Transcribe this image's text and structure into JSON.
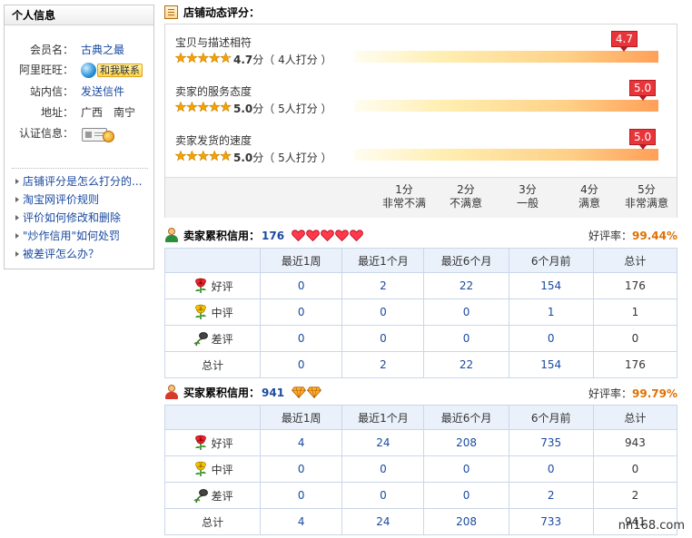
{
  "sidebar": {
    "title": "个人信息",
    "member_label": "会员名：",
    "member_value": "古典之最",
    "aliww_label": "阿里旺旺：",
    "aliww_button": "和我联系",
    "message_label": "站内信：",
    "message_value": "发送信件",
    "address_label": "地址：",
    "address_value": "广西　南宁",
    "cert_label": "认证信息：",
    "links": [
      "店铺评分是怎么打分的...",
      "淘宝网评价规则",
      "评价如何修改和删除",
      "\"炒作信用\"如何处罚",
      "被差评怎么办？"
    ]
  },
  "dsr": {
    "title": "店铺动态评分：",
    "items": [
      {
        "name": "宝贝与描述相符",
        "score": "4.7",
        "unit": "分",
        "count": "（ 4人打分 ）",
        "flag": "4.7",
        "value": 4.7,
        "stars": 4.7
      },
      {
        "name": "卖家的服务态度",
        "score": "5.0",
        "unit": "分",
        "count": "（ 5人打分 ）",
        "flag": "5.0",
        "value": 5.0,
        "stars": 5.0
      },
      {
        "name": "卖家发货的速度",
        "score": "5.0",
        "unit": "分",
        "count": "（ 5人打分 ）",
        "flag": "5.0",
        "value": 5.0,
        "stars": 5.0
      }
    ],
    "scale": [
      {
        "score": "1分",
        "label": "非常不满"
      },
      {
        "score": "2分",
        "label": "不满意"
      },
      {
        "score": "3分",
        "label": "一般"
      },
      {
        "score": "4分",
        "label": "满意"
      },
      {
        "score": "5分",
        "label": "非常满意"
      }
    ]
  },
  "seller": {
    "title": "卖家累积信用：",
    "credit": "176",
    "level_icon": "heart-icon",
    "level_count": 5,
    "good_rate_label": "好评率：",
    "good_rate": "99.44%",
    "headers": [
      "",
      "最近1周",
      "最近1个月",
      "最近6个月",
      "6个月前",
      "总计"
    ],
    "rows": [
      {
        "kind": "好评",
        "icon": "red-flower-icon",
        "values": [
          "0",
          "2",
          "22",
          "154",
          "176"
        ]
      },
      {
        "kind": "中评",
        "icon": "yellow-flower-icon",
        "values": [
          "0",
          "0",
          "0",
          "1",
          "1"
        ]
      },
      {
        "kind": "差评",
        "icon": "wilted-flower-icon",
        "values": [
          "0",
          "0",
          "0",
          "0",
          "0"
        ]
      },
      {
        "kind": "总计",
        "icon": "",
        "values": [
          "0",
          "2",
          "22",
          "154",
          "176"
        ]
      }
    ]
  },
  "buyer": {
    "title": "买家累积信用：",
    "credit": "941",
    "level_icon": "diamond-icon",
    "level_count": 2,
    "good_rate_label": "好评率：",
    "good_rate": "99.79%",
    "headers": [
      "",
      "最近1周",
      "最近1个月",
      "最近6个月",
      "6个月前",
      "总计"
    ],
    "rows": [
      {
        "kind": "好评",
        "icon": "red-flower-icon",
        "values": [
          "4",
          "24",
          "208",
          "735",
          "943"
        ]
      },
      {
        "kind": "中评",
        "icon": "yellow-flower-icon",
        "values": [
          "0",
          "0",
          "0",
          "0",
          "0"
        ]
      },
      {
        "kind": "差评",
        "icon": "wilted-flower-icon",
        "values": [
          "0",
          "0",
          "0",
          "2",
          "2"
        ]
      },
      {
        "kind": "总计",
        "icon": "",
        "values": [
          "4",
          "24",
          "208",
          "733",
          "941"
        ]
      }
    ]
  },
  "colors": {
    "link": "#1b4aa0",
    "rate": "#e07000",
    "flag": "#e8353a",
    "star": "#f5a300"
  },
  "watermark": "nn168.com"
}
